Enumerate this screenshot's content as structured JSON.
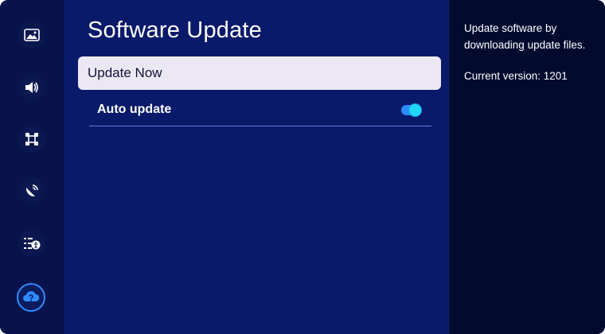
{
  "sidebar": {
    "items": [
      {
        "icon": "picture-icon",
        "active": false
      },
      {
        "icon": "sound-icon",
        "active": false
      },
      {
        "icon": "connection-icon",
        "active": false
      },
      {
        "icon": "satellite-icon",
        "active": false
      },
      {
        "icon": "accessibility-icon",
        "active": false
      },
      {
        "icon": "support-help-icon",
        "active": true
      }
    ]
  },
  "main": {
    "title": "Software Update",
    "items": [
      {
        "label": "Update Now",
        "focused": true
      },
      {
        "label": "Auto update",
        "toggle": "on"
      }
    ]
  },
  "info": {
    "description": "Update software by downloading update files.",
    "version": "Current version: 1201"
  },
  "colors": {
    "main_bg": "#0a1a6b",
    "rail_bg": "#07134a",
    "panel_bg": "#010b2e",
    "focus_bg": "#ece8f3",
    "accent": "#2f8cff",
    "toggle_knob": "#20d6f5"
  }
}
